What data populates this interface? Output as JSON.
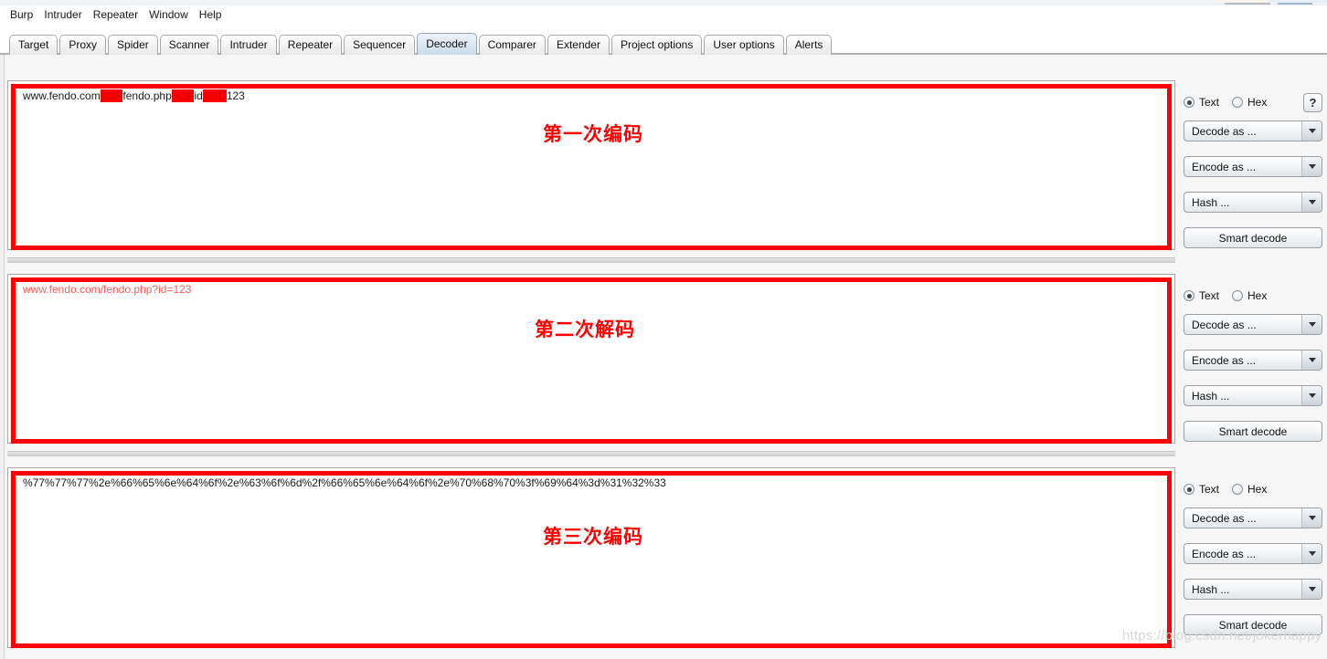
{
  "app": {
    "title": "Burp Suite Decoder"
  },
  "menubar": {
    "items": [
      {
        "label": "Burp"
      },
      {
        "label": "Intruder"
      },
      {
        "label": "Repeater"
      },
      {
        "label": "Window"
      },
      {
        "label": "Help"
      }
    ]
  },
  "tabs": [
    {
      "label": "Target",
      "selected": false
    },
    {
      "label": "Proxy",
      "selected": false
    },
    {
      "label": "Spider",
      "selected": false
    },
    {
      "label": "Scanner",
      "selected": false
    },
    {
      "label": "Intruder",
      "selected": false
    },
    {
      "label": "Repeater",
      "selected": false
    },
    {
      "label": "Sequencer",
      "selected": false
    },
    {
      "label": "Decoder",
      "selected": true
    },
    {
      "label": "Comparer",
      "selected": false
    },
    {
      "label": "Extender",
      "selected": false
    },
    {
      "label": "Project options",
      "selected": false
    },
    {
      "label": "User options",
      "selected": false
    },
    {
      "label": "Alerts",
      "selected": false
    }
  ],
  "sections": [
    {
      "id": "section-1",
      "annotation": "第一次编码",
      "text_prefix": "www.fendo.com",
      "segments": [
        {
          "text": "www.fendo.com",
          "highlight": false
        },
        {
          "text": "%2F",
          "highlight": true
        },
        {
          "text": "fendo.php",
          "highlight": false
        },
        {
          "text": "%3F",
          "highlight": true
        },
        {
          "text": "id",
          "highlight": false
        },
        {
          "text": "%3D",
          "highlight": true
        },
        {
          "text": "123",
          "highlight": false
        }
      ],
      "full_text": "www.fendo.com%2Ffendo.php%3Fid%3D123",
      "controls": {
        "radio_text": "Text",
        "radio_hex": "Hex",
        "radio_selected": "Text",
        "help_label": "?",
        "has_help": true,
        "decode_as": "Decode as ...",
        "encode_as": "Encode as ...",
        "hash": "Hash ...",
        "smart_decode": "Smart decode"
      }
    },
    {
      "id": "section-2",
      "annotation": "第二次解码",
      "segments": [
        {
          "text": "www.fendo.com/fendo.php?id=123",
          "highlight": false
        }
      ],
      "full_text": "www.fendo.com/fendo.php?id=123",
      "controls": {
        "radio_text": "Text",
        "radio_hex": "Hex",
        "radio_selected": "Text",
        "help_label": "?",
        "has_help": false,
        "decode_as": "Decode as ...",
        "encode_as": "Encode as ...",
        "hash": "Hash ...",
        "smart_decode": "Smart decode"
      }
    },
    {
      "id": "section-3",
      "annotation": "第三次编码",
      "segments": [
        {
          "text": "%77%77%77%2e%66%65%6e%64%6f%2e%63%6f%6d%2f%66%65%6e%64%6f%2e%70%68%70%3f%69%64%3d%31%32%33",
          "highlight": false
        }
      ],
      "full_text": "%77%77%77%2e%66%65%6e%64%6f%2e%63%6f%6d%2f%66%65%6e%64%6f%2e%70%68%70%3f%69%64%3d%31%32%33",
      "controls": {
        "radio_text": "Text",
        "radio_hex": "Hex",
        "radio_selected": "Text",
        "help_label": "?",
        "has_help": false,
        "decode_as": "Decode as ...",
        "encode_as": "Encode as ...",
        "hash": "Hash ...",
        "smart_decode": "Smart decode"
      }
    }
  ],
  "watermark": "https://blog.csdn.net/jokerhappy",
  "colors": {
    "annotation_red": "#ff0000",
    "highlight_bg": "#ff0000",
    "decoded_text": "#ff5a5a",
    "selected_tab": "#d6e3ef"
  }
}
